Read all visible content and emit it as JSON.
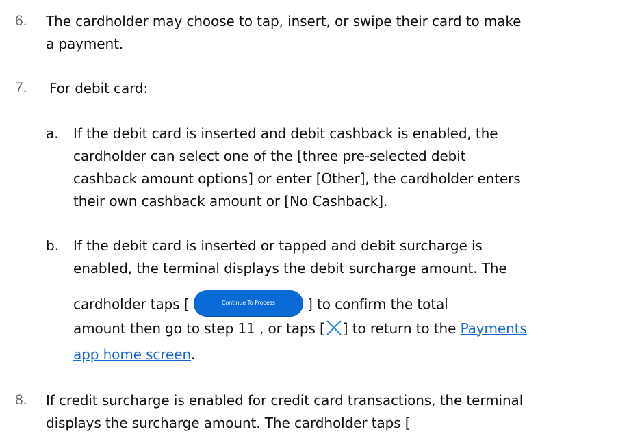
{
  "item6": {
    "number": "6.",
    "line1": "The cardholder may choose to tap, insert, or swipe their card to make",
    "line2": "a payment."
  },
  "item7": {
    "number": "7.",
    "text": "For debit card:"
  },
  "item7a": {
    "letter": "a.",
    "line1": "If the debit card is inserted and debit cashback is enabled, the",
    "line2": "cardholder can select one of the [three pre-selected debit",
    "line3": "cashback amount options] or enter [Other], the cardholder enters",
    "line4": "their own cashback amount or [No Cashback]."
  },
  "item7b": {
    "letter": "b.",
    "line1": "If the debit card is inserted or tapped and debit surcharge is",
    "line2": "enabled, the terminal displays the debit surcharge amount. The",
    "line3_prefix": "cardholder taps [",
    "button_label": "Continue To Process",
    "line3_suffix": "] to confirm the total",
    "line4_prefix": "amount then go to step 11 , or taps [",
    "line4_mid": "] to return to the ",
    "link_part1": "Payments",
    "link_part2": "app home screen",
    "line5_suffix": "."
  },
  "item8": {
    "number": "8.",
    "line1": "If credit surcharge is enabled for credit card transactions, the terminal",
    "line2": "displays the surcharge amount.  The cardholder taps ["
  },
  "colors": {
    "button_blue": "#0a6bd6",
    "link_blue": "#1669d3",
    "icon_blue": "#2f7de1"
  }
}
